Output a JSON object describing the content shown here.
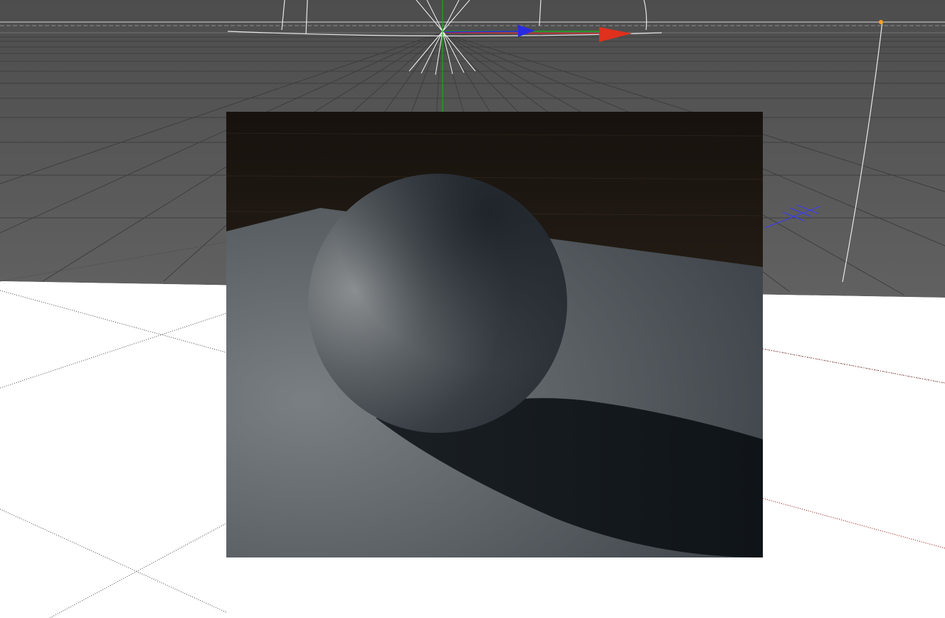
{
  "viewport": {
    "type": "3d-perspective-viewport",
    "colors": {
      "floor_far": "#5a5a5a",
      "floor_near": "#ffffff",
      "grid_far": "#3f3f3f",
      "grid_near": "#000000",
      "axis_x": "#e0301e",
      "axis_y": "#1ea81e",
      "axis_z": "#2a2ae0",
      "light_gizmo": "#ffffff",
      "camera_dot": "#f5a21a"
    },
    "gizmo": {
      "name": "move-gizmo",
      "axes": [
        "x-axis-arrow",
        "y-axis-line",
        "z-axis-arrow"
      ]
    },
    "light": {
      "name": "light-icon"
    }
  },
  "render_region": {
    "name": "interactive-render-region",
    "scene": [
      "backdrop",
      "floor-plane",
      "sphere",
      "shadow"
    ],
    "colors": {
      "backdrop": "#1c1712",
      "floor": "#5c6266",
      "sphere": "#5d6266",
      "shadow": "#12171b"
    }
  }
}
